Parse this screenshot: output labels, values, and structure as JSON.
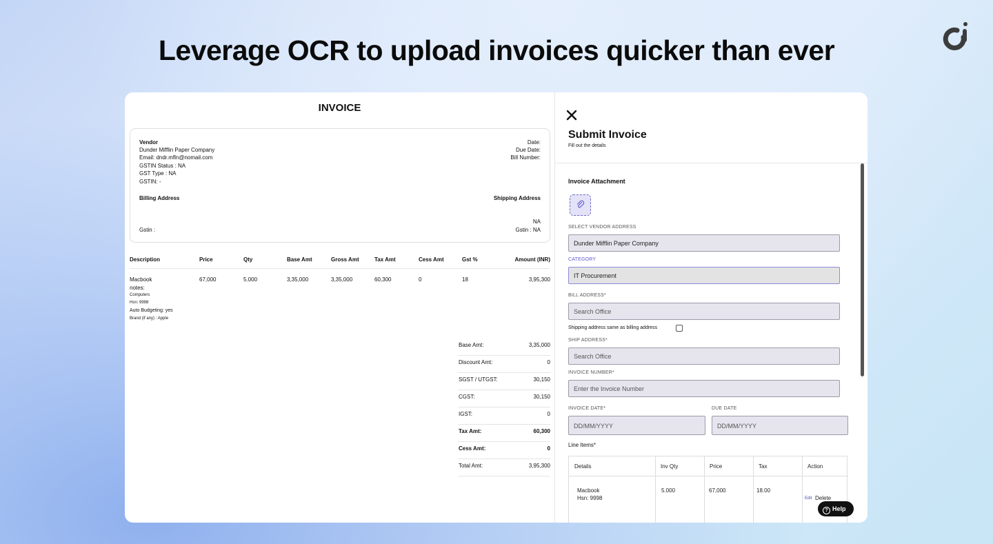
{
  "headline": "Leverage OCR to upload invoices quicker than ever",
  "invoice": {
    "title": "INVOICE",
    "vendor": {
      "heading": "Vendor",
      "name": "Dunder Mifflin Paper Company",
      "email": "Email: dndr.mfln@nomail.com",
      "gstin_status": "GSTIN Status : NA",
      "gst_type": "GST Type : NA",
      "gstin": "GSTIN: -"
    },
    "dates": {
      "date_label": "Date:",
      "due_label": "Due Date:",
      "bill_label": "Bill Number:"
    },
    "billing_address": "Billing Address",
    "shipping_address": "Shipping Address",
    "billing_gstin": "Gstin :",
    "shipping_na": "NA",
    "shipping_gstin": "Gstin : NA",
    "columns": [
      "Description",
      "Price",
      "Qty",
      "Base Amt",
      "Gross Amt",
      "Tax Amt",
      "Cess Amt",
      "Gst %",
      "Amount (INR)"
    ],
    "item": {
      "name": "Macbook",
      "notes": "notes:",
      "category": "Computers",
      "hsn": "Hsn: 9998",
      "auto_budget": "Auto Budgeting: yes",
      "brand": "Brand (if any) : Apple",
      "price": "67,000",
      "qty": "5.000",
      "base_amt": "3,35,000",
      "gross_amt": "3,35,000",
      "tax_amt": "60,300",
      "cess_amt": "0",
      "gst_pct": "18",
      "amount": "3,95,300"
    },
    "summary": [
      {
        "label": "Base Amt:",
        "value": "3,35,000",
        "bold": false
      },
      {
        "label": "Discount Amt:",
        "value": "0",
        "bold": false
      },
      {
        "label": "SGST / UTGST:",
        "value": "30,150",
        "bold": false
      },
      {
        "label": "CGST:",
        "value": "30,150",
        "bold": false
      },
      {
        "label": "IGST:",
        "value": "0",
        "bold": false
      },
      {
        "label": "Tax Amt:",
        "value": "60,300",
        "bold": true
      },
      {
        "label": "Cess Amt:",
        "value": "0",
        "bold": true
      },
      {
        "label": "Total Amt:",
        "value": "3,95,300",
        "bold": false
      }
    ]
  },
  "drawer": {
    "title": "Submit Invoice",
    "subtitle": "Fill out the details",
    "attachment_title": "Invoice Attachment",
    "vendor_address_label": "SELECT VENDOR ADDRESS",
    "vendor_address_value": "Dunder Mifflin Paper Company",
    "category_label": "CATEGORY",
    "category_value": "IT Procurement",
    "bill_address_label": "BILL ADDRESS*",
    "bill_address_placeholder": "Search Office",
    "same_as_billing_label": "Shipping address same as billing address",
    "ship_address_label": "SHIP ADDRESS*",
    "ship_address_placeholder": "Search Office",
    "invoice_number_label": "INVOICE NUMBER*",
    "invoice_number_placeholder": "Enter the Invoice Number",
    "invoice_date_label": "INVOICE DATE*",
    "invoice_date_placeholder": "DD/MM/YYYY",
    "due_date_label": "DUE DATE",
    "due_date_placeholder": "DD/MM/YYYY",
    "line_items_title": "Line Items*",
    "line_columns": [
      "Details",
      "Inv Qty",
      "Price",
      "Tax",
      "Action"
    ],
    "line_item": {
      "name": "Macbook",
      "hsn": "Hsn: 9998",
      "qty": "5.000",
      "price": "67,000",
      "tax": "18.00",
      "edit": "Edit",
      "delete": "Delete"
    }
  },
  "help_label": "Help",
  "colors": {
    "accent": "#5b57c9",
    "field_bg": "#e6e5ee",
    "help_bg": "#111111"
  }
}
